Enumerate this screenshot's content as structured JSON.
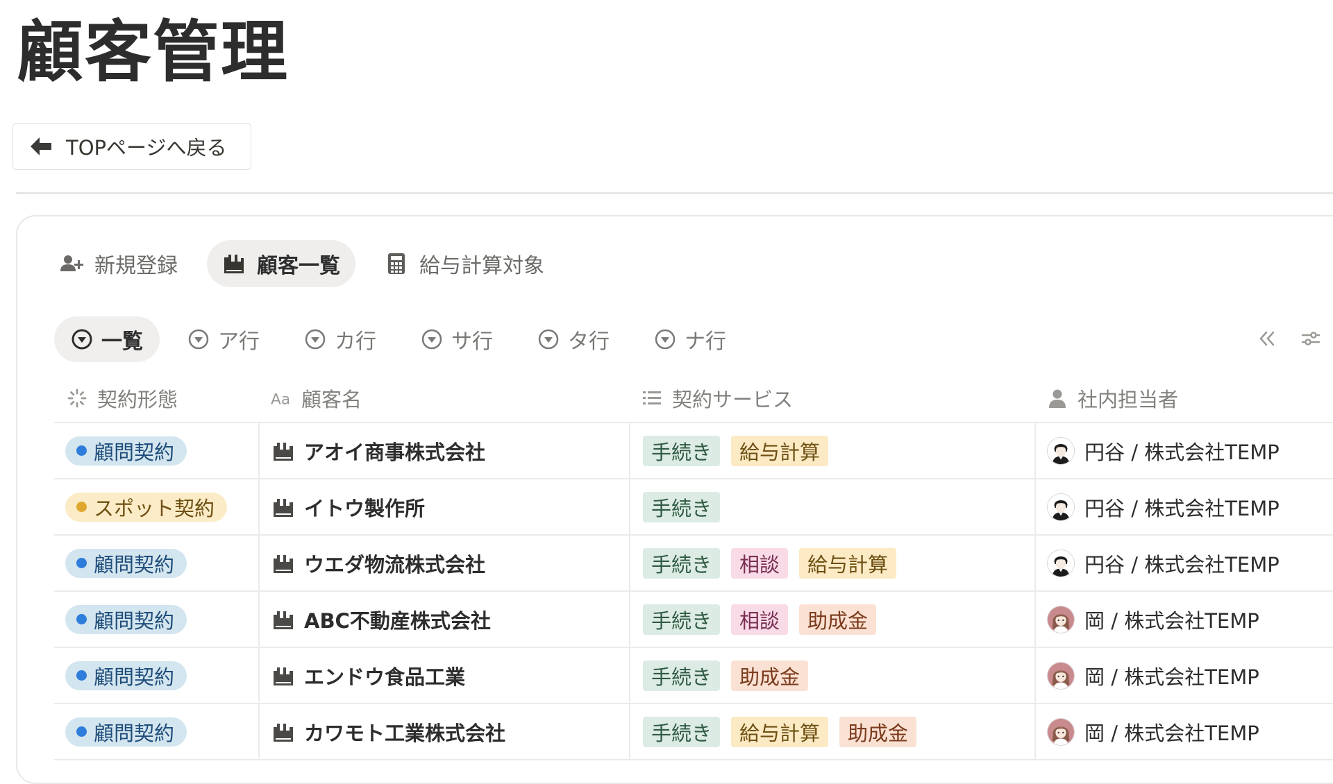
{
  "page": {
    "title": "顧客管理",
    "back_button_label": "TOPページへ戻る"
  },
  "view_tabs": [
    {
      "label": "新規登録",
      "icon": "person-add-icon",
      "active": false
    },
    {
      "label": "顧客一覧",
      "icon": "building-icon",
      "active": true
    },
    {
      "label": "給与計算対象",
      "icon": "calculator-icon",
      "active": false
    }
  ],
  "filter_tabs": [
    {
      "label": "一覧",
      "active": true
    },
    {
      "label": "ア行",
      "active": false
    },
    {
      "label": "カ行",
      "active": false
    },
    {
      "label": "サ行",
      "active": false
    },
    {
      "label": "タ行",
      "active": false
    },
    {
      "label": "ナ行",
      "active": false
    }
  ],
  "toolbar": {
    "collapse_icon": "double-chevron-left-icon",
    "settings_icon": "sliders-icon"
  },
  "columns": [
    {
      "label": "契約形態",
      "icon": "status-loading-icon"
    },
    {
      "label": "顧客名",
      "icon": "text-aa-icon"
    },
    {
      "label": "契約サービス",
      "icon": "list-icon"
    },
    {
      "label": "社内担当者",
      "icon": "person-icon"
    }
  ],
  "colors": {
    "advisory_badge_bg": "#d3e5ef",
    "advisory_dot": "#2f7ddb",
    "spot_badge_bg": "#fbecc7",
    "spot_dot": "#dfa72e",
    "tag_procedure_bg": "#dcebe3",
    "tag_payroll_bg": "#fbeac4",
    "tag_consult_bg": "#f8dbe7",
    "tag_subsidy_bg": "#fbe1d3"
  },
  "rows": [
    {
      "contract_type": "顧問契約",
      "contract_kind": "advisory",
      "customer": "アオイ商事株式会社",
      "services": [
        "手続き",
        "給与計算"
      ],
      "service_kinds": [
        "procedure",
        "payroll"
      ],
      "assignee": "円谷 / 株式会社TEMP",
      "avatar": "male-avatar"
    },
    {
      "contract_type": "スポット契約",
      "contract_kind": "spot",
      "customer": "イトウ製作所",
      "services": [
        "手続き"
      ],
      "service_kinds": [
        "procedure"
      ],
      "assignee": "円谷 / 株式会社TEMP",
      "avatar": "male-avatar"
    },
    {
      "contract_type": "顧問契約",
      "contract_kind": "advisory",
      "customer": "ウエダ物流株式会社",
      "services": [
        "手続き",
        "相談",
        "給与計算"
      ],
      "service_kinds": [
        "procedure",
        "consult",
        "payroll"
      ],
      "assignee": "円谷 / 株式会社TEMP",
      "avatar": "male-avatar"
    },
    {
      "contract_type": "顧問契約",
      "contract_kind": "advisory",
      "customer": "ABC不動産株式会社",
      "services": [
        "手続き",
        "相談",
        "助成金"
      ],
      "service_kinds": [
        "procedure",
        "consult",
        "subsidy"
      ],
      "assignee": "岡 / 株式会社TEMP",
      "avatar": "female-avatar"
    },
    {
      "contract_type": "顧問契約",
      "contract_kind": "advisory",
      "customer": "エンドウ食品工業",
      "services": [
        "手続き",
        "助成金"
      ],
      "service_kinds": [
        "procedure",
        "subsidy"
      ],
      "assignee": "岡 / 株式会社TEMP",
      "avatar": "female-avatar"
    },
    {
      "contract_type": "顧問契約",
      "contract_kind": "advisory",
      "customer": "カワモト工業株式会社",
      "services": [
        "手続き",
        "給与計算",
        "助成金"
      ],
      "service_kinds": [
        "procedure",
        "payroll",
        "subsidy"
      ],
      "assignee": "岡 / 株式会社TEMP",
      "avatar": "female-avatar"
    }
  ]
}
